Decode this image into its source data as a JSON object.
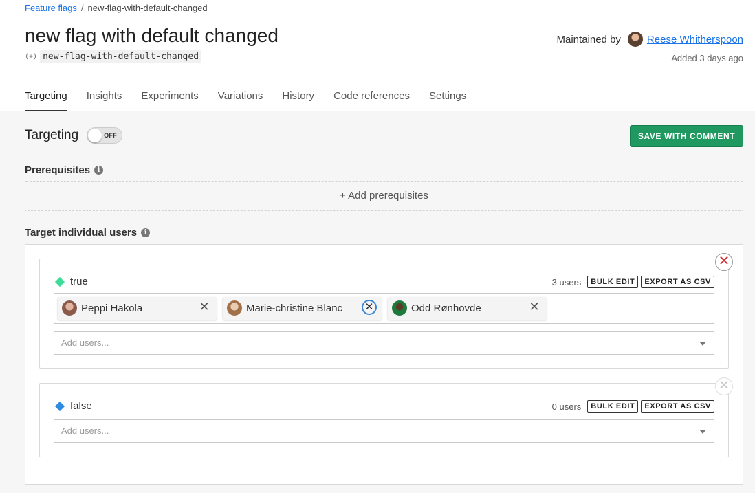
{
  "breadcrumb": {
    "parent": "Feature flags",
    "current": "new-flag-with-default-changed"
  },
  "flag": {
    "title": "new flag with default changed",
    "key_icon": "(+)",
    "key": "new-flag-with-default-changed"
  },
  "maintainer": {
    "label": "Maintained by",
    "name": "Reese Whitherspoon",
    "added": "Added 3 days ago"
  },
  "tabs": [
    {
      "label": "Targeting",
      "active": true
    },
    {
      "label": "Insights"
    },
    {
      "label": "Experiments"
    },
    {
      "label": "Variations"
    },
    {
      "label": "History"
    },
    {
      "label": "Code references"
    },
    {
      "label": "Settings"
    }
  ],
  "targeting": {
    "title": "Targeting",
    "toggle_state": "OFF",
    "save_label": "SAVE WITH COMMENT"
  },
  "prerequisites": {
    "label": "Prerequisites",
    "add_label": "+ Add prerequisites"
  },
  "individual": {
    "label": "Target individual users",
    "variations": [
      {
        "name": "true",
        "color": "#3ddc97",
        "count": "3 users",
        "bulk_edit": "BULK EDIT",
        "export": "EXPORT AS CSV",
        "users": [
          "Peppi Hakola",
          "Marie-christine Blanc",
          "Odd Rønhovde"
        ],
        "placeholder": "Add users..."
      },
      {
        "name": "false",
        "color": "#2e8be0",
        "count": "0 users",
        "bulk_edit": "BULK EDIT",
        "export": "EXPORT AS CSV",
        "users": [],
        "placeholder": "Add users..."
      }
    ]
  },
  "icons": {
    "close": "✕",
    "info": "i"
  },
  "colors": {
    "link": "#1a73e8",
    "save_button": "#1f9960",
    "remove_red": "#d03030",
    "focus_ring": "#3c87d5"
  }
}
